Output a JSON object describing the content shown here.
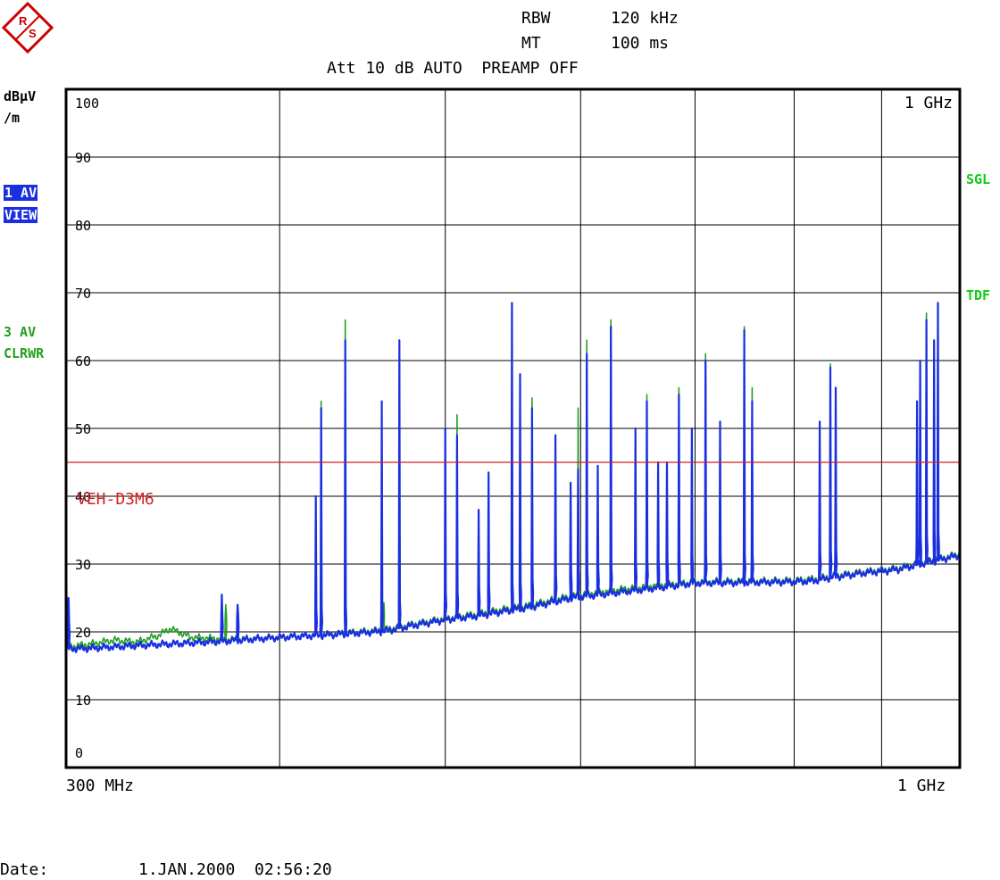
{
  "header": {
    "rbw_label": "RBW",
    "rbw_value": "120 kHz",
    "mt_label": "MT",
    "mt_value": "100 ms",
    "att_line": "Att 10 dB AUTO  PREAMP OFF"
  },
  "left_panel": {
    "unit_line1": "dBµV",
    "unit_line2": "/m",
    "trace1_line1": "1 AV",
    "trace1_line2": "VIEW",
    "trace3_line1": "3 AV",
    "trace3_line2": "CLRWR"
  },
  "right_panel": {
    "sgl": "SGL",
    "tdf": "TDF"
  },
  "footer": {
    "date_label": "Date:",
    "date_value": "1.JAN.2000  02:56:20"
  },
  "colors": {
    "trace_blue": "#1a2fe0",
    "trace_green": "#22a022",
    "limit_red": "#d42020",
    "label_green": "#11cc11",
    "logo_red": "#cc0000"
  },
  "chart_data": {
    "type": "line",
    "title": "",
    "xlabel": "",
    "ylabel": "dBµV/m",
    "x_start_label": "300 MHz",
    "x_stop_label": "1 GHz",
    "top_right_label": "1 GHz",
    "xlim": [
      300,
      1000
    ],
    "x_unit": "MHz",
    "x_scale": "log",
    "ylim": [
      0,
      100
    ],
    "y_ticks": [
      0,
      10,
      20,
      30,
      40,
      50,
      60,
      70,
      80,
      90,
      100
    ],
    "x_gridlines": [
      400,
      500,
      600,
      700,
      800,
      900
    ],
    "grid": true,
    "limit_line": {
      "name": "VEH-D3M6",
      "value": 45
    },
    "series": [
      {
        "name": "1 AV",
        "color": "#1a2fe0",
        "baseline": [
          [
            300,
            17.5
          ],
          [
            310,
            17.6
          ],
          [
            330,
            18.0
          ],
          [
            350,
            18.3
          ],
          [
            375,
            18.7
          ],
          [
            400,
            19.2
          ],
          [
            430,
            19.6
          ],
          [
            460,
            20.1
          ],
          [
            480,
            21.0
          ],
          [
            500,
            21.8
          ],
          [
            520,
            22.3
          ],
          [
            540,
            23.0
          ],
          [
            560,
            23.6
          ],
          [
            580,
            24.5
          ],
          [
            600,
            25.2
          ],
          [
            630,
            25.8
          ],
          [
            660,
            26.4
          ],
          [
            700,
            27.2
          ],
          [
            760,
            27.3
          ],
          [
            800,
            27.4
          ],
          [
            820,
            27.5
          ],
          [
            840,
            28.0
          ],
          [
            880,
            28.7
          ],
          [
            920,
            29.2
          ],
          [
            960,
            30.3
          ],
          [
            1000,
            31.3
          ]
        ],
        "peaks": [
          [
            301,
            25
          ],
          [
            370,
            25.5
          ],
          [
            378,
            24
          ],
          [
            420,
            40
          ],
          [
            423,
            53
          ],
          [
            437,
            63
          ],
          [
            459,
            54
          ],
          [
            470,
            63
          ],
          [
            500,
            50
          ],
          [
            508,
            49
          ],
          [
            523,
            38
          ],
          [
            530,
            43.5
          ],
          [
            547,
            68.5
          ],
          [
            553,
            58
          ],
          [
            562,
            53
          ],
          [
            580,
            49
          ],
          [
            592,
            42
          ],
          [
            598,
            44
          ],
          [
            605,
            61
          ],
          [
            614,
            44.5
          ],
          [
            625,
            65
          ],
          [
            646,
            50
          ],
          [
            656,
            54
          ],
          [
            666,
            45
          ],
          [
            674,
            45
          ],
          [
            685,
            55
          ],
          [
            697,
            50
          ],
          [
            710,
            60
          ],
          [
            724,
            51
          ],
          [
            748,
            64.5
          ],
          [
            756,
            54
          ],
          [
            828,
            51
          ],
          [
            840,
            59
          ],
          [
            846,
            56
          ],
          [
            944,
            54
          ],
          [
            948,
            60
          ],
          [
            956,
            66
          ],
          [
            966,
            63
          ],
          [
            971,
            68.5
          ]
        ]
      },
      {
        "name": "3 AV",
        "color": "#22a022",
        "baseline": [
          [
            300,
            17.8
          ],
          [
            310,
            18.2
          ],
          [
            320,
            18.8
          ],
          [
            330,
            18.5
          ],
          [
            340,
            19.5
          ],
          [
            345,
            20.5
          ],
          [
            355,
            19.2
          ],
          [
            375,
            18.9
          ],
          [
            400,
            19.2
          ],
          [
            430,
            19.7
          ],
          [
            460,
            20.3
          ],
          [
            480,
            21.2
          ],
          [
            500,
            22.0
          ],
          [
            520,
            22.6
          ],
          [
            540,
            23.3
          ],
          [
            560,
            23.9
          ],
          [
            580,
            24.8
          ],
          [
            600,
            25.5
          ],
          [
            630,
            26.2
          ],
          [
            660,
            26.8
          ],
          [
            700,
            27.4
          ],
          [
            760,
            27.5
          ],
          [
            800,
            27.6
          ],
          [
            820,
            27.8
          ],
          [
            840,
            28.2
          ],
          [
            880,
            28.9
          ],
          [
            920,
            29.4
          ],
          [
            960,
            30.5
          ],
          [
            1000,
            31.5
          ]
        ],
        "peaks": [
          [
            301,
            21
          ],
          [
            372,
            24
          ],
          [
            423,
            54
          ],
          [
            437,
            66
          ],
          [
            460,
            24
          ],
          [
            470,
            61
          ],
          [
            508,
            52
          ],
          [
            547,
            67
          ],
          [
            562,
            54.5
          ],
          [
            598,
            53
          ],
          [
            605,
            63
          ],
          [
            625,
            66
          ],
          [
            656,
            55
          ],
          [
            685,
            56
          ],
          [
            710,
            61
          ],
          [
            748,
            65
          ],
          [
            756,
            56
          ],
          [
            840,
            59.5
          ],
          [
            956,
            67
          ],
          [
            971,
            68
          ]
        ]
      }
    ]
  }
}
